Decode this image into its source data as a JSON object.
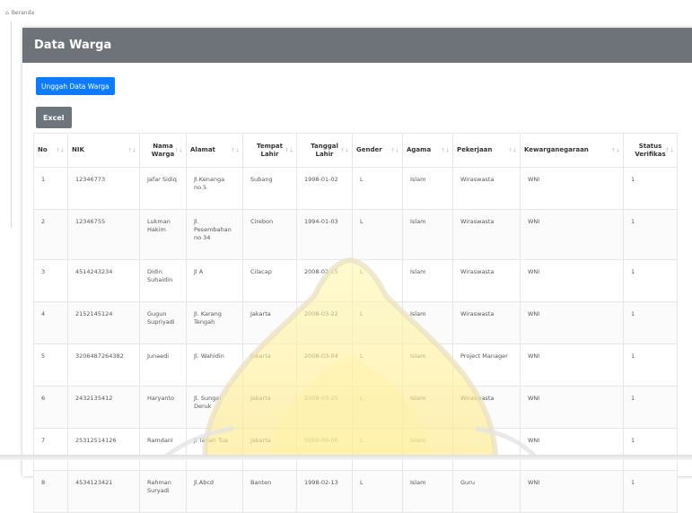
{
  "breadcrumb": {
    "label": "Beranda"
  },
  "card": {
    "title": "Data Warga"
  },
  "buttons": {
    "upload": "Unggah Data Warga",
    "excel": "Excel"
  },
  "table": {
    "columns": [
      {
        "label": "No",
        "sortable": true,
        "sorted": "asc"
      },
      {
        "label": "NIK",
        "sortable": true
      },
      {
        "label": "Nama Warga",
        "sortable": true
      },
      {
        "label": "Alamat",
        "sortable": true
      },
      {
        "label": "Tempat Lahir",
        "sortable": true
      },
      {
        "label": "Tanggal Lahir",
        "sortable": true
      },
      {
        "label": "Gender",
        "sortable": true
      },
      {
        "label": "Agama",
        "sortable": true
      },
      {
        "label": "Pekerjaan",
        "sortable": true
      },
      {
        "label": "Kewarganegaraan",
        "sortable": true
      },
      {
        "label": "Status Verifikas",
        "sortable": true
      }
    ],
    "rows": [
      [
        "1",
        "12346773",
        "Jafar Sidiq",
        "Jl.Kenanga no.5",
        "Subang",
        "1998-01-02",
        "L",
        "Islam",
        "Wiraswasta",
        "WNI",
        "1"
      ],
      [
        "2",
        "12346755",
        "Lukman Hakim",
        "Jl. Pesembahan no 34",
        "Cirebon",
        "1994-01-03",
        "L",
        "Islam",
        "Wiraswasta",
        "WNI",
        "1"
      ],
      [
        "3",
        "4514243234",
        "Didin Suhaidin",
        "Jl A",
        "Cilacap",
        "2008-02-15",
        "L",
        "Islam",
        "Wiraswasta",
        "WNI",
        "1"
      ],
      [
        "4",
        "2152145124",
        "Gugun Supriyadi",
        "Jl. Karang Tengah",
        "Jakarta",
        "2008-03-22",
        "L",
        "Islam",
        "Wiraswasta",
        "WNI",
        "1"
      ],
      [
        "5",
        "3206487264382",
        "Junaedi",
        "Jl. Wahidin",
        "Jakarta",
        "2008-03-04",
        "L",
        "Islam",
        "Project Manager",
        "WNI",
        "1"
      ],
      [
        "6",
        "2432135412",
        "Haryanto",
        "Jl. Sungai Deruk",
        "Jakarta",
        "2008-03-25",
        "L",
        "Islam",
        "Wiraswasta",
        "WNI",
        "1"
      ],
      [
        "7",
        "25312514126",
        "Ramdani",
        "Jl Tanah Tua",
        "Jakarta",
        "0000-00-00",
        "L",
        "Islam",
        "",
        "WNI",
        "1"
      ],
      [
        "8",
        "4534123421",
        "Rahman Suryadi",
        "Jl.Abcd",
        "Banten",
        "1998-02-13",
        "L",
        "Islam",
        "Guru",
        "WNI",
        "1"
      ]
    ]
  },
  "colors": {
    "header_bg": "#6d7379",
    "primary": "#0d7bff",
    "secondary": "#6c757d",
    "watermark": "#fff6a8"
  }
}
